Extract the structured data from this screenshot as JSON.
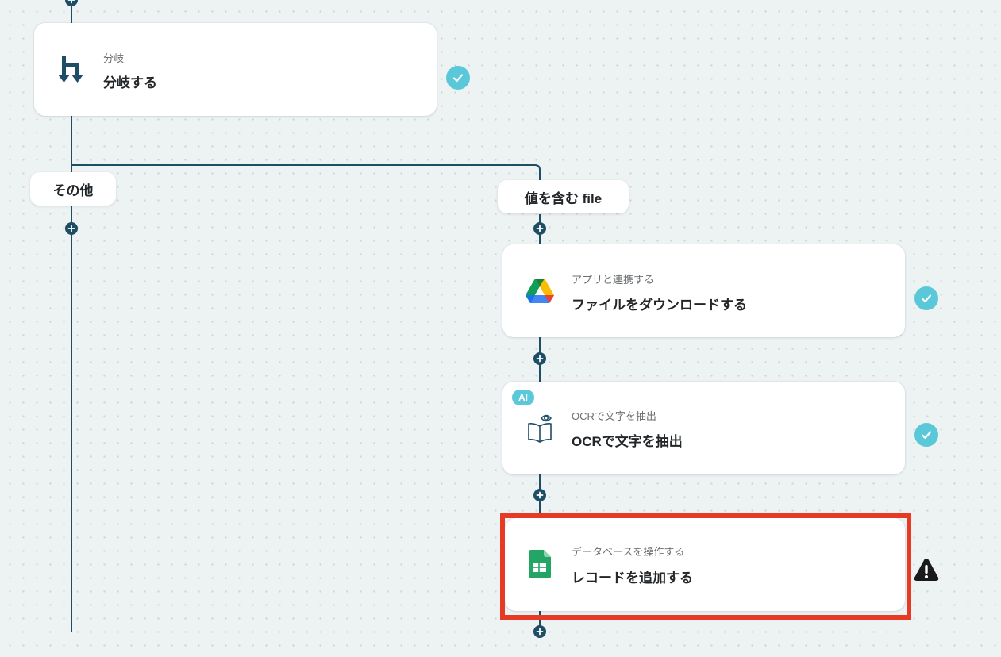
{
  "flow": {
    "branch_node": {
      "subtitle": "分岐",
      "title": "分岐する",
      "icon": "branch-icon",
      "status": "completed"
    },
    "branches": {
      "other_label": "その他",
      "condition_label": "値を含む file"
    },
    "steps": [
      {
        "subtitle": "アプリと連携する",
        "title": "ファイルをダウンロードする",
        "icon": "google-drive-icon",
        "status": "completed"
      },
      {
        "subtitle": "OCRで文字を抽出",
        "title": "OCRで文字を抽出",
        "icon": "ocr-book-icon",
        "badge": "AI",
        "status": "completed"
      },
      {
        "subtitle": "データベースを操作する",
        "title": "レコードを追加する",
        "icon": "google-sheets-icon",
        "status": "warning",
        "highlighted": true
      }
    ]
  },
  "colors": {
    "canvas_background": "#edf2f3",
    "connector_line": "#1e4d66",
    "status_completed": "#5ac8d8",
    "status_warning": "#1a1a1a",
    "highlight_border": "#e63a25",
    "ai_badge": "#5ac8d8"
  }
}
